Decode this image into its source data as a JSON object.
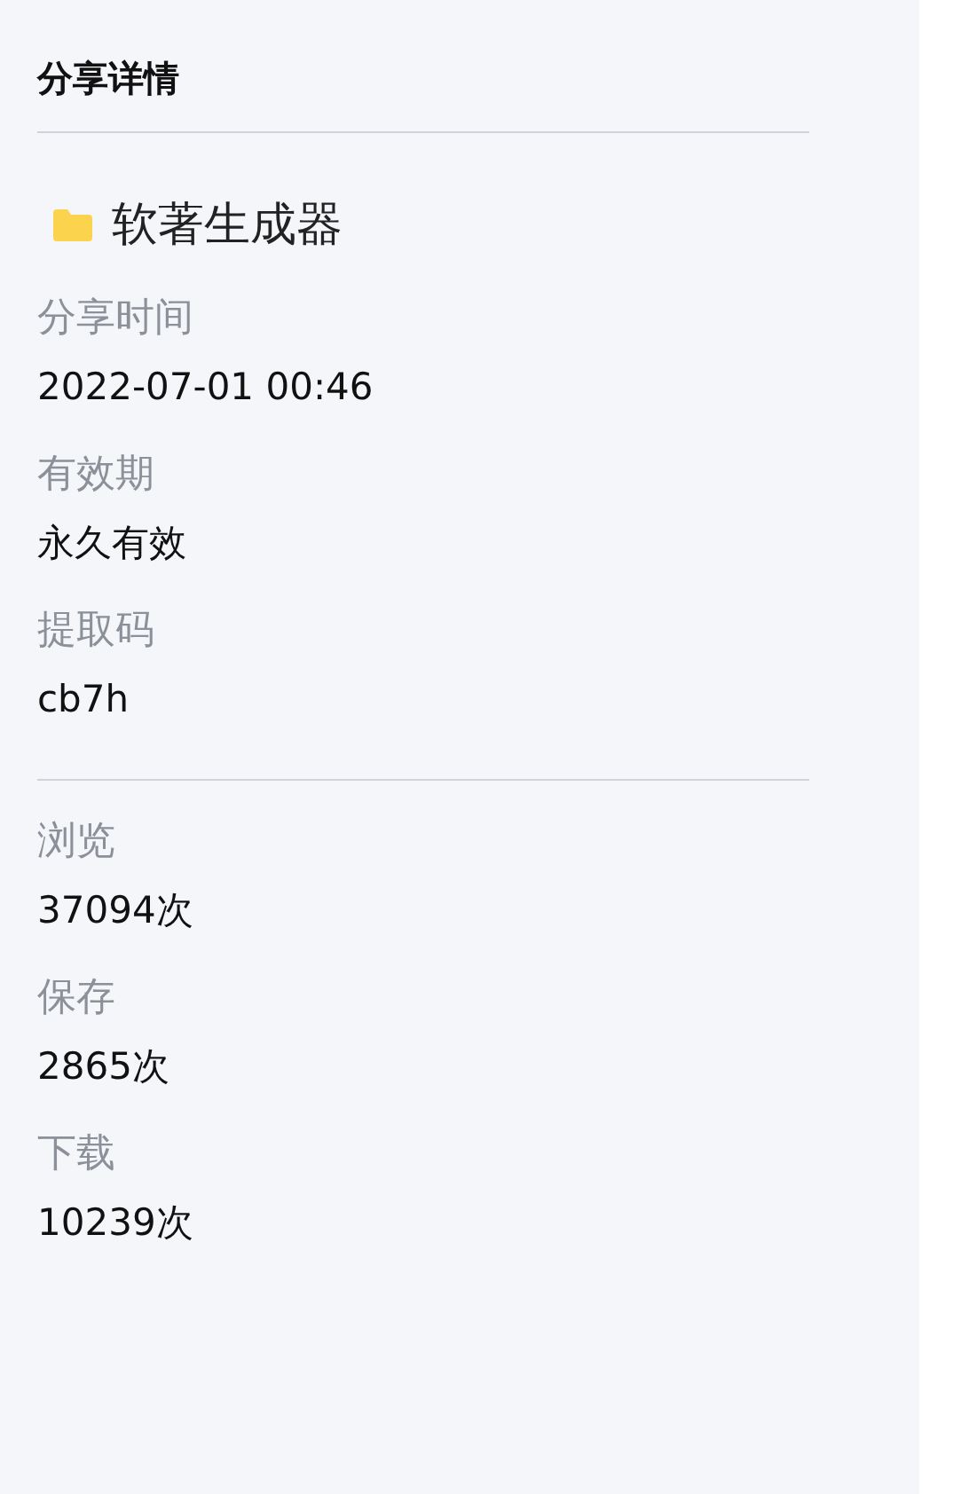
{
  "title": "分享详情",
  "file": {
    "name": "软著生成器"
  },
  "details": [
    {
      "label": "分享时间",
      "value": "2022-07-01 00:46"
    },
    {
      "label": "有效期",
      "value": "永久有效"
    },
    {
      "label": "提取码",
      "value": "cb7h"
    }
  ],
  "stats": [
    {
      "label": "浏览",
      "value": "37094次"
    },
    {
      "label": "保存",
      "value": "2865次"
    },
    {
      "label": "下载",
      "value": "10239次"
    }
  ]
}
